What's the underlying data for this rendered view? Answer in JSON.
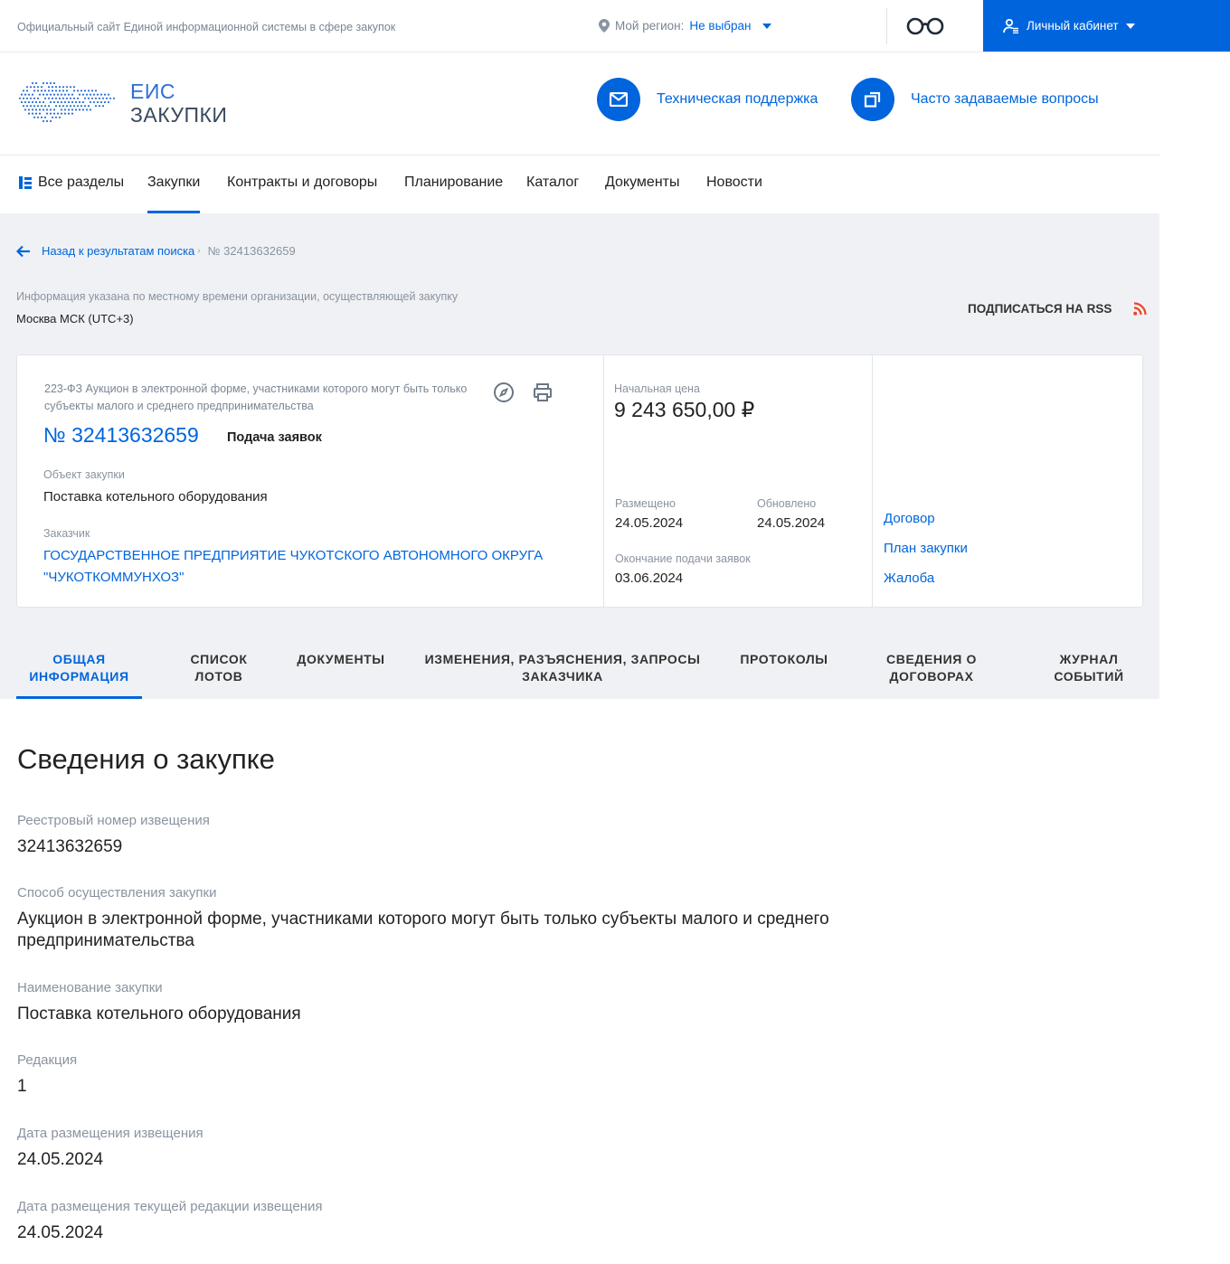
{
  "topbar": {
    "site_title": "Официальный сайт Единой информационной системы в сфере закупок",
    "region_label": "Мой регион:",
    "region_value": "Не выбран",
    "accessibility_icon": "glasses-icon",
    "cabinet_label": "Личный кабинет"
  },
  "header": {
    "logo_line1": "ЕИС",
    "logo_line2": "ЗАКУПКИ",
    "support_label": "Техническая поддержка",
    "faq_label": "Часто задаваемые вопросы"
  },
  "nav": {
    "all_sections": "Все разделы",
    "items": [
      "Закупки",
      "Контракты и договоры",
      "Планирование",
      "Каталог",
      "Документы",
      "Новости"
    ]
  },
  "breadcrumb": {
    "back": "Назад к результатам поиска",
    "current": "№ 32413632659"
  },
  "timezone": {
    "note": "Информация указана по местному времени организации, осуществляющей закупку",
    "value": "Москва МСК (UTC+3)"
  },
  "rss_label": "ПОДПИСАТЬСЯ НА RSS",
  "card": {
    "type": "223-ФЗ Аукцион в электронной форме, участниками которого могут быть только субъекты малого и среднего предпринимательства",
    "number": "№ 32413632659",
    "stage": "Подача заявок",
    "object_label": "Объект закупки",
    "object_value": "Поставка котельного оборудования",
    "customer_label": "Заказчик",
    "customer_value": "ГОСУДАРСТВЕННОЕ ПРЕДПРИЯТИЕ ЧУКОТСКОГО АВТОНОМНОГО ОКРУГА \"ЧУКОТКОММУНХОЗ\"",
    "price_label": "Начальная цена",
    "price_value": "9 243 650,00 ₽",
    "posted_label": "Размещено",
    "posted_value": "24.05.2024",
    "updated_label": "Обновлено",
    "updated_value": "24.05.2024",
    "deadline_label": "Окончание подачи заявок",
    "deadline_value": "03.06.2024",
    "links": [
      "Договор",
      "План закупки",
      "Жалоба"
    ]
  },
  "tabs": [
    {
      "line1": "ОБЩАЯ",
      "line2": "ИНФОРМАЦИЯ"
    },
    {
      "line1": "СПИСОК",
      "line2": "ЛОТОВ"
    },
    {
      "line1": "ДОКУМЕНТЫ",
      "line2": ""
    },
    {
      "line1": "ИЗМЕНЕНИЯ, РАЗЪЯСНЕНИЯ, ЗАПРОСЫ",
      "line2": "ЗАКАЗЧИКА"
    },
    {
      "line1": "ПРОТОКОЛЫ",
      "line2": ""
    },
    {
      "line1": "СВЕДЕНИЯ О",
      "line2": "ДОГОВОРАХ"
    },
    {
      "line1": "ЖУРНАЛ",
      "line2": "СОБЫТИЙ"
    }
  ],
  "main": {
    "title": "Сведения о закупке",
    "fields": [
      {
        "label": "Реестровый номер извещения",
        "value": "32413632659"
      },
      {
        "label": "Способ осуществления закупки",
        "value": "Аукцион в электронной форме, участниками которого могут быть только субъекты малого и среднего предпринимательства"
      },
      {
        "label": "Наименование закупки",
        "value": "Поставка котельного оборудования"
      },
      {
        "label": "Редакция",
        "value": "1"
      },
      {
        "label": "Дата размещения извещения",
        "value": "24.05.2024"
      },
      {
        "label": "Дата размещения текущей редакции извещения",
        "value": "24.05.2024"
      }
    ]
  },
  "colors": {
    "accent": "#0065dd",
    "gray_bg": "#eff1f4",
    "rss": "#e8472b"
  }
}
